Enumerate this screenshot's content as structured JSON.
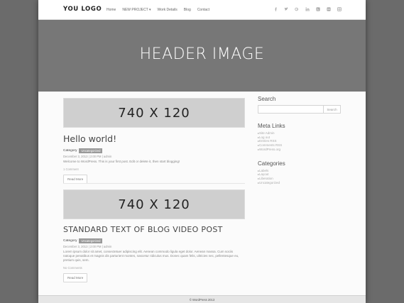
{
  "nav": {
    "logo": "YOU LOGO",
    "menu": [
      "Home",
      "NEW PROJECT ▾",
      "Work Details",
      "Blog",
      "Contact"
    ],
    "socials": [
      "facebook-icon",
      "twitter-icon",
      "google-plus-icon",
      "linkedin-icon",
      "rss-icon",
      "flickr-icon",
      "instagram-icon"
    ]
  },
  "hero": {
    "title": "HEADER IMAGE"
  },
  "posts": [
    {
      "placeholder": "740 X 120",
      "title": "Hello world!",
      "category_label": "Category",
      "category_tag": "Uncategorized",
      "meta": "December 3, 2013 | 2:00 PM | admin",
      "excerpt": "Welcome to WordPress. This is your first post. Edit or delete it, then start blogging!",
      "comments": "1 Comment",
      "button": "Read More"
    },
    {
      "placeholder": "740 X 120",
      "title": "STANDARD TEXT OF BLOG VIDEO POST",
      "category_label": "Category",
      "category_tag": "Uncategorized",
      "meta": "December 3, 2013 | 2:00 PM | admin",
      "excerpt": "Lorem ipsum dolor sit amet, consectetuer adipiscing elit. Aenean commodo ligula eget dolor. Aenean massa. Cum sociis natoque penatibus et magnis dis parturient montes, nascetur ridiculus mus. Donec quam felis, ultricies nec, pellentesque eu, pretium quis, sem.",
      "comments": "No Comments",
      "button": "Read More"
    }
  ],
  "sidebar": {
    "search_title": "Search",
    "search_button": "Search",
    "meta_title": "Meta Links",
    "meta_links": [
      "Site Admin",
      "Log out",
      "Entries RSS",
      "Comments RSS",
      "WordPress.org"
    ],
    "categories_title": "Categories",
    "categories": [
      "Labels",
      "Layout",
      "Liberation",
      "Uncategorized"
    ]
  },
  "footer": {
    "text": "© WordPress 2013"
  }
}
